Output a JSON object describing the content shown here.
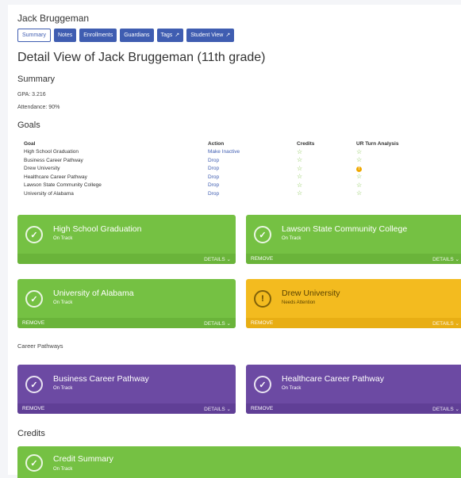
{
  "student": {
    "name": "Jack Bruggeman"
  },
  "tabs": [
    {
      "label": "Summary",
      "active": true,
      "external": false
    },
    {
      "label": "Notes",
      "active": false,
      "external": false
    },
    {
      "label": "Enrollments",
      "active": false,
      "external": false
    },
    {
      "label": "Guardians",
      "active": false,
      "external": false
    },
    {
      "label": "Tags",
      "active": false,
      "external": true
    },
    {
      "label": "Student View",
      "active": false,
      "external": true
    }
  ],
  "detail_title": "Detail View of Jack Bruggeman (11th grade)",
  "summary": {
    "heading": "Summary",
    "gpa": "GPA: 3.216",
    "attendance": "Attendance: 90%"
  },
  "goals": {
    "heading": "Goals",
    "columns": [
      "Goal",
      "Action",
      "Credits",
      "UR Turn Analysis"
    ],
    "rows": [
      {
        "goal": "High School Graduation",
        "action": "Make Inactive",
        "credits": "star-icon",
        "analysis": "star-icon"
      },
      {
        "goal": "Business Career Pathway",
        "action": "Drop",
        "credits": "star-icon",
        "analysis": "star-icon"
      },
      {
        "goal": "Drew University",
        "action": "Drop",
        "credits": "star-icon",
        "analysis": "warning-icon"
      },
      {
        "goal": "Healthcare Career Pathway",
        "action": "Drop",
        "credits": "star-icon",
        "analysis": "star-icon"
      },
      {
        "goal": "Lawson State Community College",
        "action": "Drop",
        "credits": "star-icon",
        "analysis": "star-icon"
      },
      {
        "goal": "University of Alabama",
        "action": "Drop",
        "credits": "star-icon",
        "analysis": "star-icon"
      }
    ]
  },
  "goal_cards": [
    {
      "title": "High School Graduation",
      "status": "On Track",
      "remove": "",
      "details": "DETAILS",
      "color": "#75c143"
    },
    {
      "title": "Lawson State Community College",
      "status": "On Track",
      "remove": "REMOVE",
      "details": "DETAILS",
      "color": "#75c143"
    },
    {
      "title": "University of Alabama",
      "status": "On Track",
      "remove": "REMOVE",
      "details": "DETAILS",
      "color": "#75c143"
    },
    {
      "title": "Drew University",
      "status": "Needs Attention",
      "remove": "REMOVE",
      "details": "DETAILS",
      "color": "#f3bb1f"
    }
  ],
  "career": {
    "heading": "Career Pathways",
    "cards": [
      {
        "title": "Business Career Pathway",
        "status": "On Track",
        "remove": "REMOVE",
        "details": "DETAILS",
        "color": "#6c4aa3"
      },
      {
        "title": "Healthcare Career Pathway",
        "status": "On Track",
        "remove": "REMOVE",
        "details": "DETAILS",
        "color": "#6c4aa3"
      }
    ]
  },
  "credits": {
    "heading": "Credits",
    "card": {
      "title": "Credit Summary",
      "status": "On Track",
      "color": "#75c143"
    }
  }
}
